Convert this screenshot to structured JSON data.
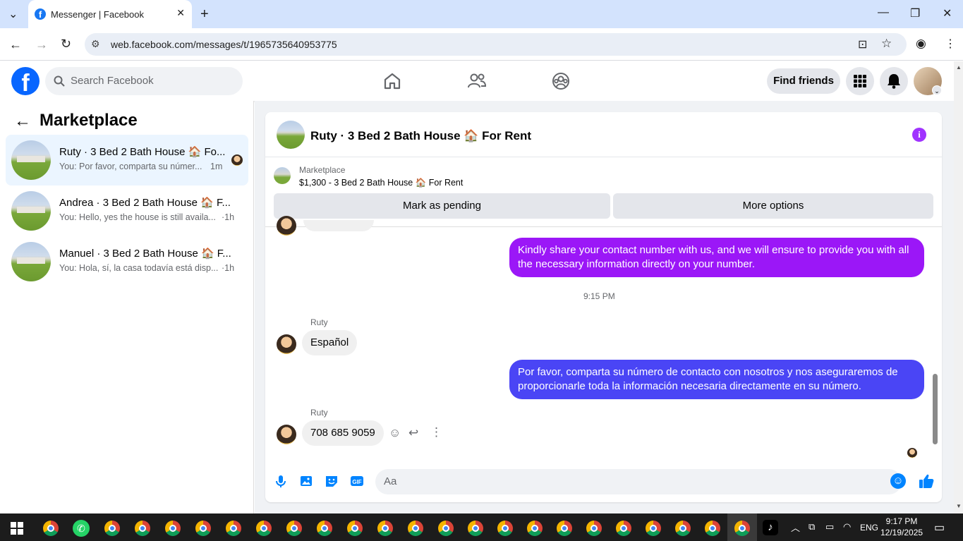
{
  "browser": {
    "tab_title": "Messenger | Facebook",
    "url": "web.facebook.com/messages/t/1965735640953775"
  },
  "header": {
    "search_placeholder": "Search Facebook",
    "find_friends": "Find friends"
  },
  "sidebar": {
    "title": "Marketplace",
    "conversations": [
      {
        "name": "Ruty · 3 Bed 2 Bath House 🏠 Fo...",
        "snippet": "You: Por favor, comparta su númer...",
        "time": "1m"
      },
      {
        "name": "Andrea · 3 Bed 2 Bath House 🏠 F...",
        "snippet": "You: Hello, yes the house is still availa...",
        "time": "·1h"
      },
      {
        "name": "Manuel · 3 Bed 2 Bath House 🏠 F...",
        "snippet": "You: Hola, sí, la casa todavía está disp...",
        "time": "·1h"
      }
    ]
  },
  "chat": {
    "title": "Ruty · 3 Bed 2 Bath House 🏠 For Rent",
    "marketplace_label": "Marketplace",
    "listing": "$1,300 - 3 Bed 2 Bath House 🏠 For Rent",
    "mark_pending": "Mark as pending",
    "more_options": "More options",
    "messages": {
      "out1": "Kindly share your contact number with us, and we will ensure to provide you with all the necessary information directly on your number.",
      "timestamp": "9:15 PM",
      "sender1": "Ruty",
      "in1": "Español",
      "out2": "Por favor, comparta su número de contacto con nosotros y nos aseguraremos de proporcionarle toda la información necesaria directamente en su número.",
      "sender2": "Ruty",
      "in2": "708 685 9059"
    },
    "composer_placeholder": "Aa"
  },
  "taskbar": {
    "lang": "ENG",
    "time": "9:17 PM",
    "date": "12/19/2025"
  },
  "colors": {
    "fb_blue": "#0866ff",
    "bubble_purple": "#9b17f7",
    "bubble_blue": "#4a45f5"
  }
}
